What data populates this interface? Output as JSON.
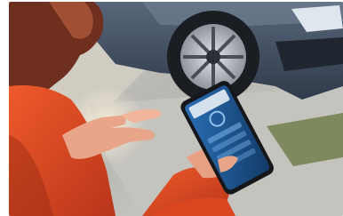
{
  "scene": {
    "subject": "person-holding-smartphone",
    "background": "car-front-wheel",
    "colors": {
      "sweater": "#e0451d",
      "sweater_shadow": "#9c2c12",
      "hair": "#6e2f1f",
      "skin": "#e9a58a",
      "car_body": "#3c4b60",
      "tire": "#1a1d22",
      "rim": "#b9bfc6",
      "phone_screen": "#1b4d86",
      "pavement": "#c3c2bd",
      "grass": "#6d7b46"
    }
  }
}
